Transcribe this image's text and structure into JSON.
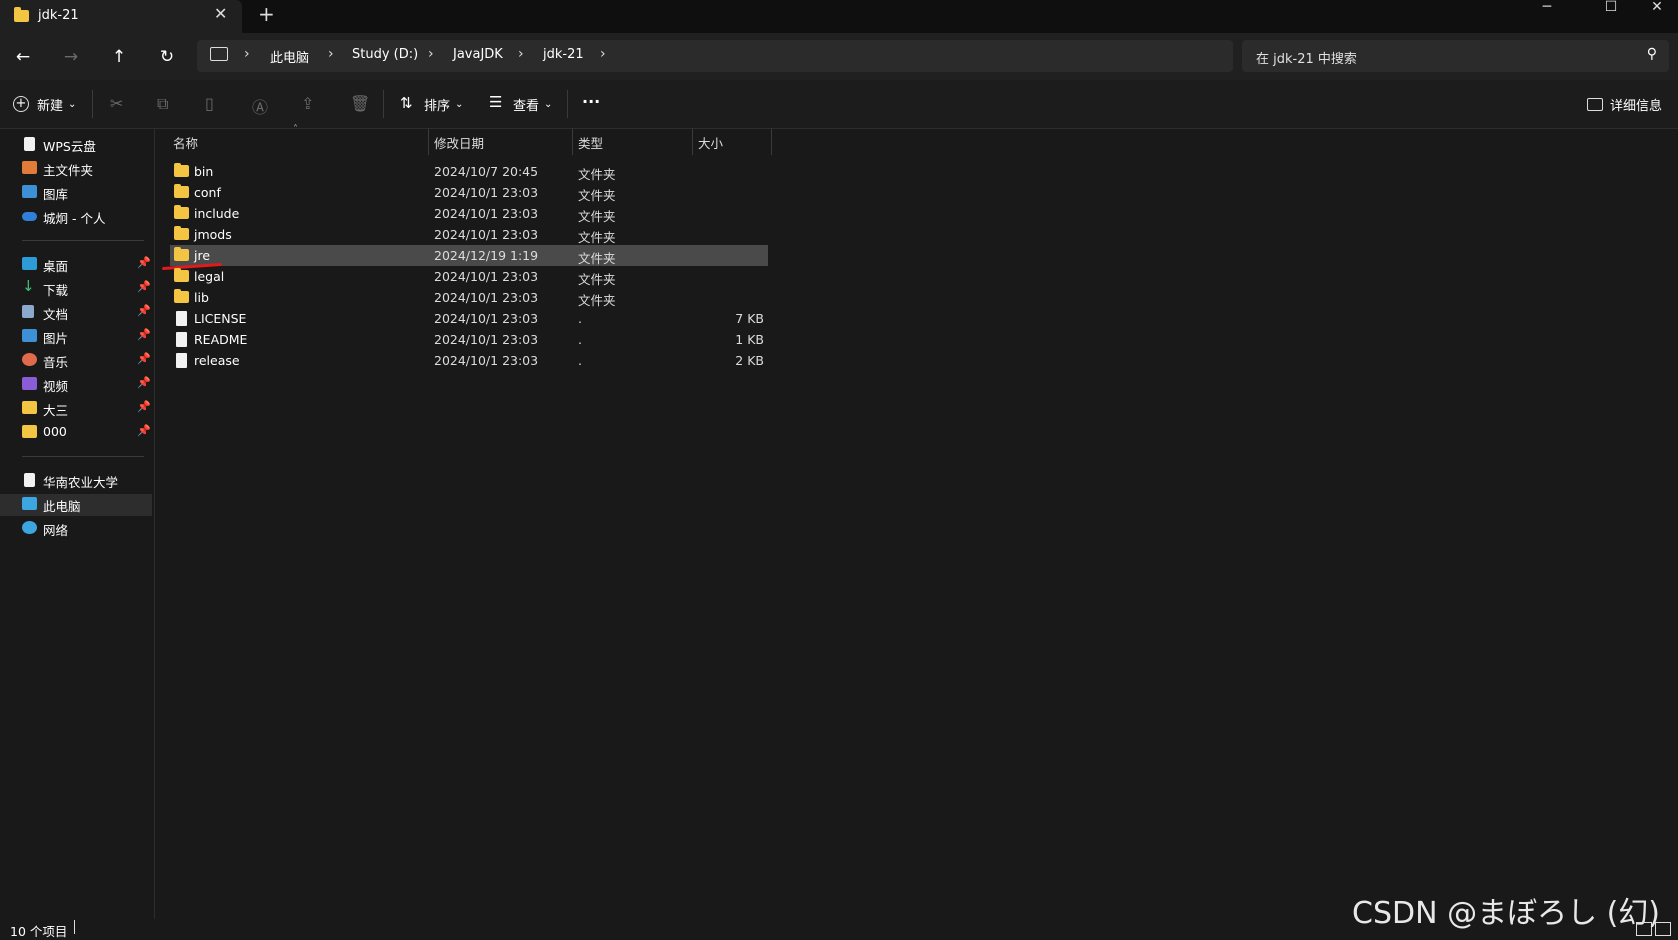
{
  "window": {
    "tab_title": "jdk-21",
    "tab_close": "✕",
    "new_tab": "+",
    "minimize": "─",
    "maximize": "☐",
    "close": "✕"
  },
  "nav": {
    "back": "←",
    "forward": "→",
    "up": "↑",
    "refresh": "↻",
    "breadcrumbs": [
      "此电脑",
      "Study (D:)",
      "JavaJDK",
      "jdk-21"
    ],
    "separator": "›",
    "search_placeholder": "在 jdk-21 中搜索"
  },
  "toolbar": {
    "new_label": "新建",
    "sort_label": "排序",
    "view_label": "查看",
    "more_label": "···",
    "details_label": "详细信息"
  },
  "sidebar": {
    "group1": [
      {
        "label": "WPS云盘",
        "icon": "document-icon"
      },
      {
        "label": "主文件夹",
        "icon": "home-icon"
      },
      {
        "label": "图库",
        "icon": "gallery-icon"
      },
      {
        "label": "城炯 - 个人",
        "icon": "onedrive-icon"
      }
    ],
    "group2": [
      {
        "label": "桌面",
        "icon": "desktop-icon",
        "pin": "📌"
      },
      {
        "label": "下载",
        "icon": "download-icon",
        "pin": "📌"
      },
      {
        "label": "文档",
        "icon": "documents-icon",
        "pin": "📌"
      },
      {
        "label": "图片",
        "icon": "pictures-icon",
        "pin": "📌"
      },
      {
        "label": "音乐",
        "icon": "music-icon",
        "pin": "📌"
      },
      {
        "label": "视频",
        "icon": "videos-icon",
        "pin": "📌"
      },
      {
        "label": "大三",
        "icon": "folder-icon",
        "pin": "📌"
      },
      {
        "label": "000",
        "icon": "folder-icon",
        "pin": "📌"
      }
    ],
    "group3": [
      {
        "label": "华南农业大学",
        "icon": "document-icon"
      },
      {
        "label": "此电脑",
        "icon": "pc-icon"
      },
      {
        "label": "网络",
        "icon": "network-icon"
      }
    ]
  },
  "columns": {
    "name": "名称",
    "date": "修改日期",
    "type": "类型",
    "size": "大小"
  },
  "files": [
    {
      "name": "bin",
      "date": "2024/10/7 20:45",
      "type": "文件夹",
      "size": "",
      "kind": "folder"
    },
    {
      "name": "conf",
      "date": "2024/10/1 23:03",
      "type": "文件夹",
      "size": "",
      "kind": "folder"
    },
    {
      "name": "include",
      "date": "2024/10/1 23:03",
      "type": "文件夹",
      "size": "",
      "kind": "folder"
    },
    {
      "name": "jmods",
      "date": "2024/10/1 23:03",
      "type": "文件夹",
      "size": "",
      "kind": "folder"
    },
    {
      "name": "jre",
      "date": "2024/12/19 1:19",
      "type": "文件夹",
      "size": "",
      "kind": "folder"
    },
    {
      "name": "legal",
      "date": "2024/10/1 23:03",
      "type": "文件夹",
      "size": "",
      "kind": "folder"
    },
    {
      "name": "lib",
      "date": "2024/10/1 23:03",
      "type": "文件夹",
      "size": "",
      "kind": "folder"
    },
    {
      "name": "LICENSE",
      "date": "2024/10/1 23:03",
      "type": ".",
      "size": "7 KB",
      "kind": "file"
    },
    {
      "name": "README",
      "date": "2024/10/1 23:03",
      "type": ".",
      "size": "1 KB",
      "kind": "file"
    },
    {
      "name": "release",
      "date": "2024/10/1 23:03",
      "type": ".",
      "size": "2 KB",
      "kind": "file"
    }
  ],
  "status": {
    "item_count": "10 个项目"
  },
  "watermark": "CSDN @まぼろし (幻)",
  "colors": {
    "background": "#191919",
    "folder": "#f4c542",
    "selection": "#4a4a4a",
    "annotation": "#e01b1b"
  }
}
